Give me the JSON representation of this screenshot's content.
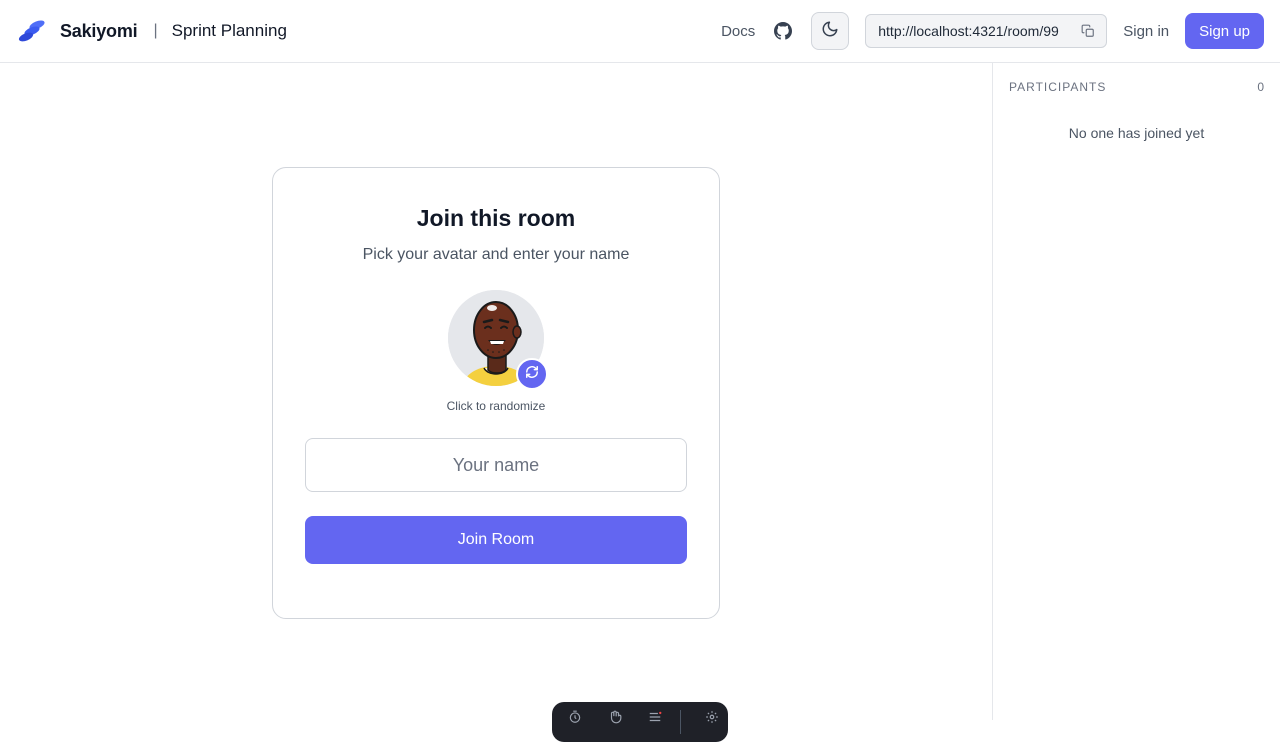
{
  "header": {
    "brand_name": "Sakiyomi",
    "separator": "|",
    "room_title": "Sprint Planning",
    "docs_label": "Docs",
    "room_url": "http://localhost:4321/room/99",
    "sign_in_label": "Sign in",
    "sign_up_label": "Sign up",
    "icons": {
      "logo": "sakiyomi-logo-icon",
      "github": "github-icon",
      "theme": "moon-icon",
      "copy": "copy-icon"
    }
  },
  "join_card": {
    "title": "Join this room",
    "subtitle": "Pick your avatar and enter your name",
    "randomize_hint": "Click to randomize",
    "name_placeholder": "Your name",
    "name_value": "",
    "join_label": "Join Room",
    "randomize_icon": "refresh-icon"
  },
  "sidebar": {
    "participants_label": "PARTICIPANTS",
    "participants_count": "0",
    "empty_message": "No one has joined yet"
  },
  "dock": {
    "items": [
      "timer-icon",
      "hand-icon",
      "menu-icon",
      "gear-icon"
    ]
  },
  "colors": {
    "accent": "#6366f1",
    "border": "#e5e7eb",
    "muted_text": "#4b5563",
    "dock_bg": "#1f2128"
  }
}
